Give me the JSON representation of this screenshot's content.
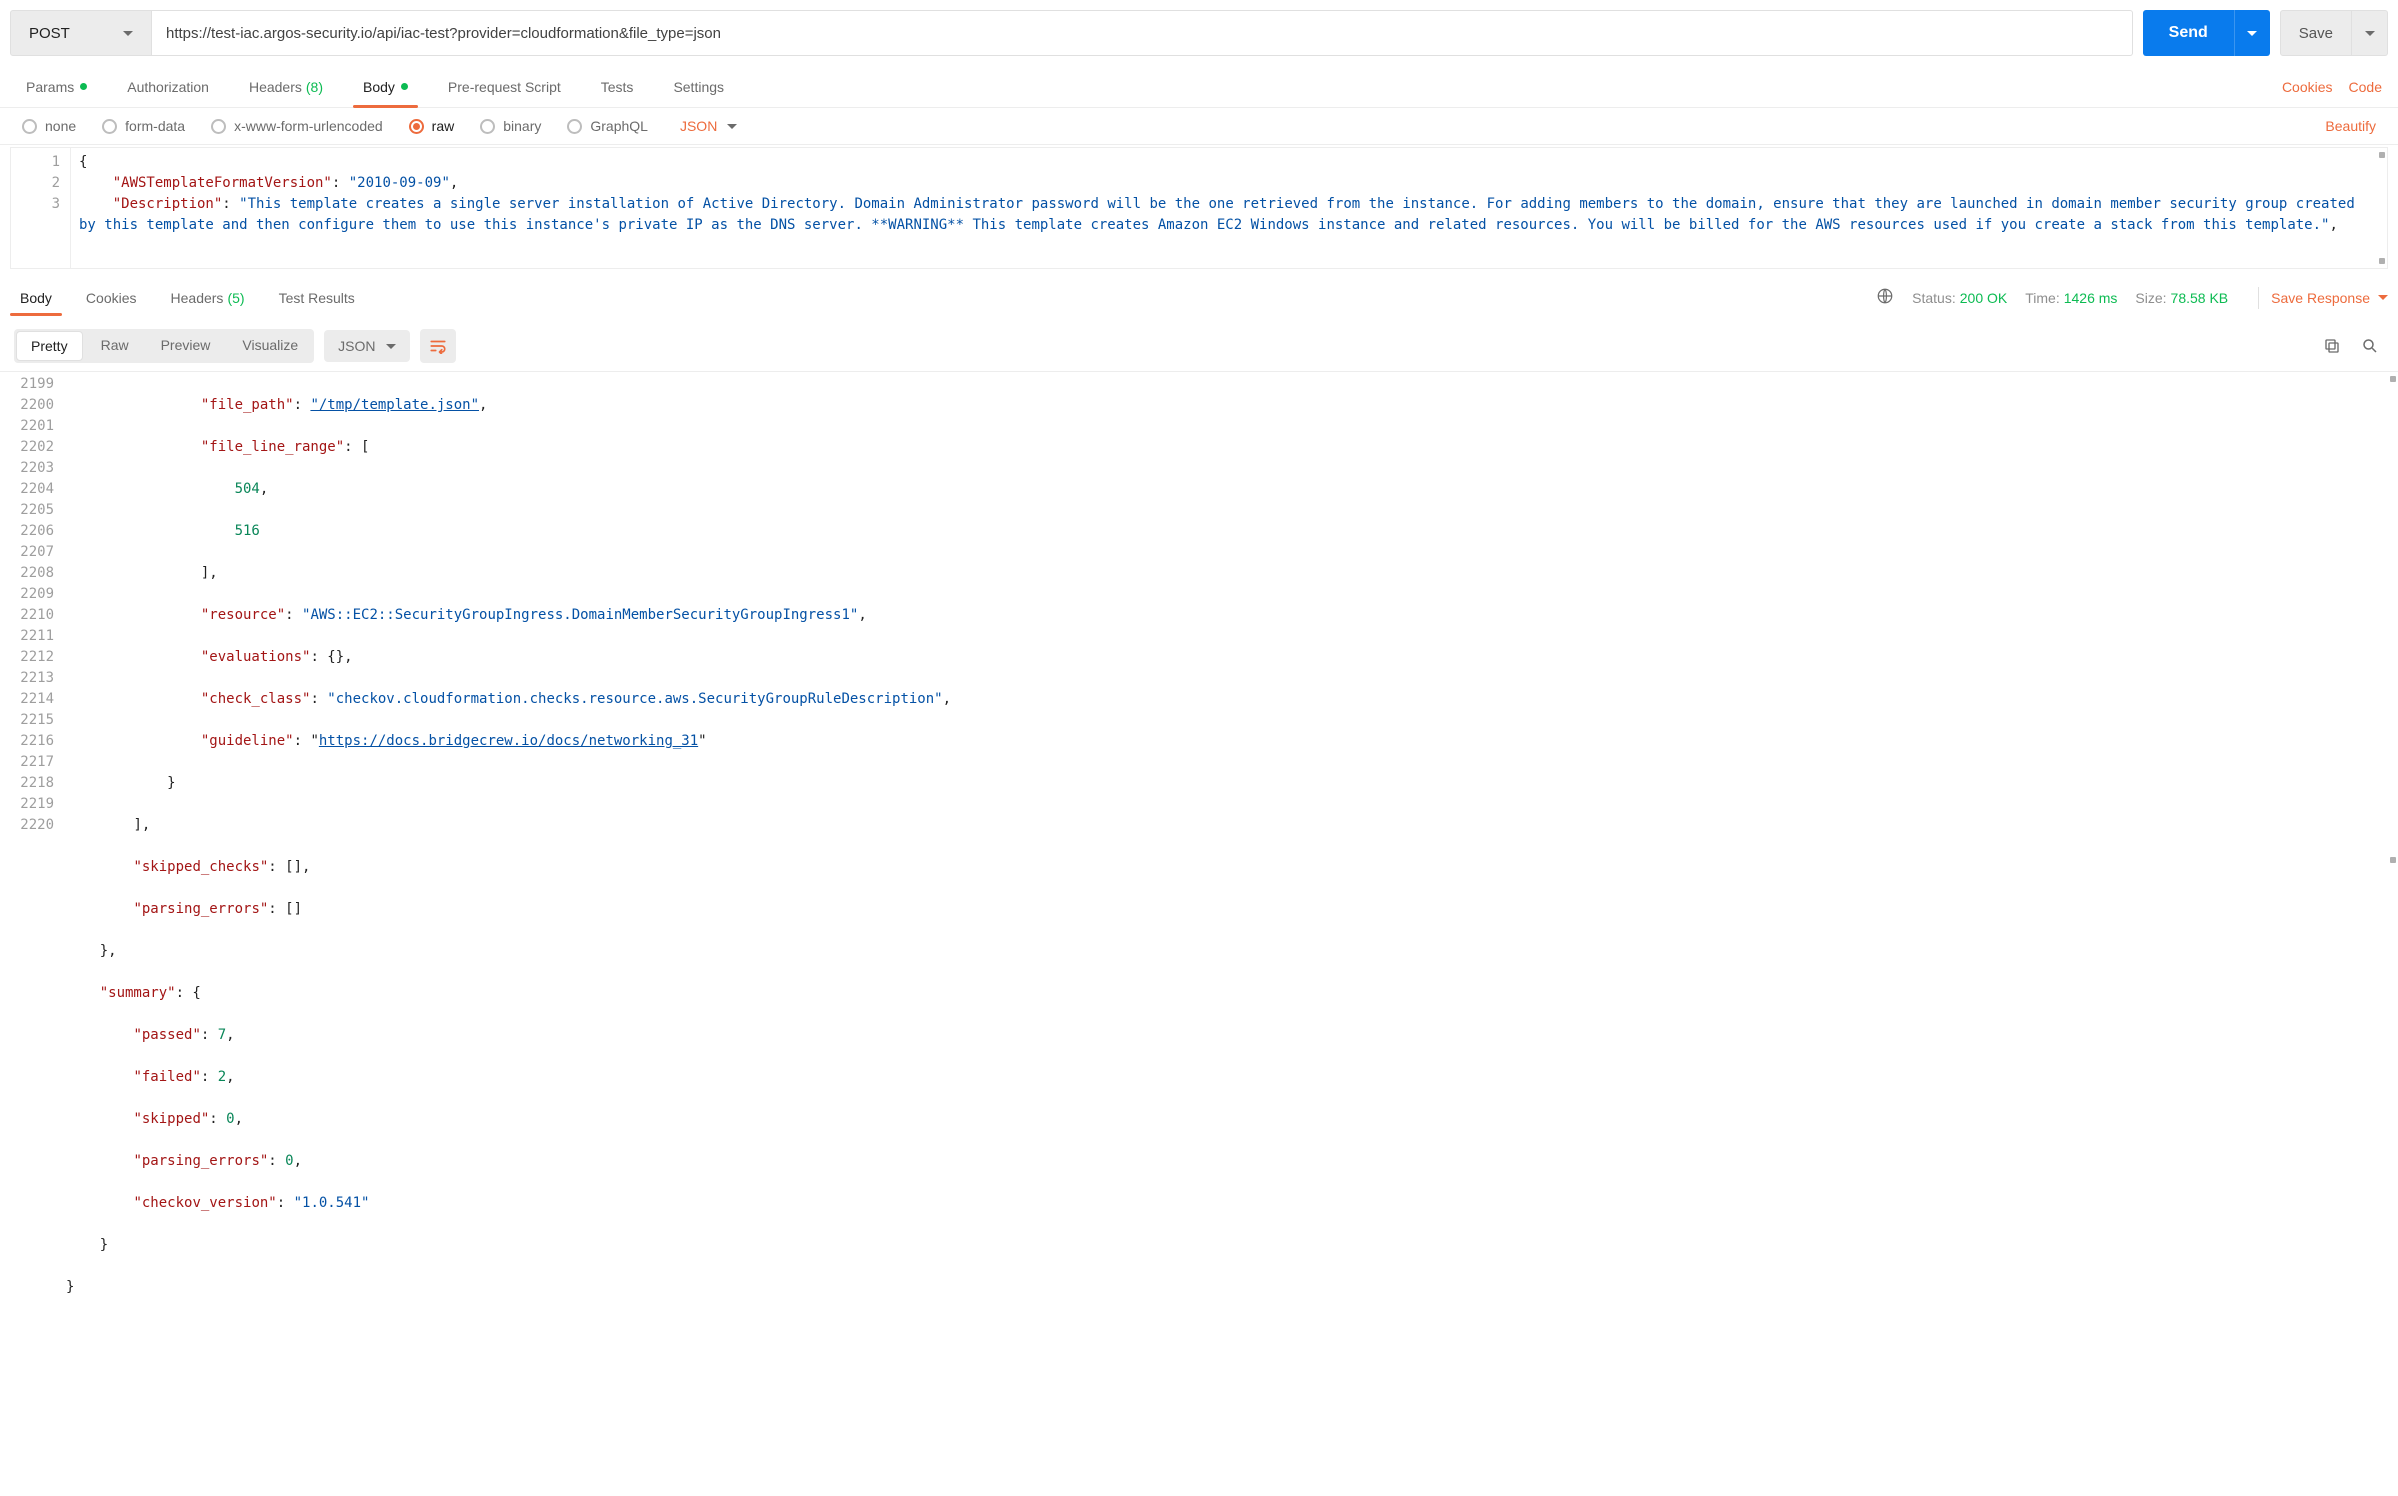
{
  "request": {
    "method": "POST",
    "url": "https://test-iac.argos-security.io/api/iac-test?provider=cloudformation&file_type=json",
    "send_label": "Send",
    "save_label": "Save"
  },
  "req_tabs": {
    "params": "Params",
    "authorization": "Authorization",
    "headers": "Headers",
    "headers_count": "(8)",
    "body": "Body",
    "prerequest": "Pre-request Script",
    "tests": "Tests",
    "settings": "Settings",
    "cookies": "Cookies",
    "code": "Code"
  },
  "body_types": {
    "none": "none",
    "form_data": "form-data",
    "urlencoded": "x-www-form-urlencoded",
    "raw": "raw",
    "binary": "binary",
    "graphql": "GraphQL",
    "format": "JSON",
    "beautify": "Beautify"
  },
  "request_body": {
    "lines": [
      "1",
      "2",
      "3"
    ],
    "l1": "{",
    "l2_k": "\"AWSTemplateFormatVersion\"",
    "l2_v": "\"2010-09-09\"",
    "l3_k": "\"Description\"",
    "l3_v": "\"This template creates a single server installation of Active Directory. Domain Administrator password will be the one retrieved from the instance. For adding members to the domain, ensure that they are launched in domain member security group created by this template and then configure them to use this instance's private IP as the DNS server. **WARNING** This template creates Amazon EC2 Windows instance and related resources. You will be billed for the AWS resources used if you create a stack from this template.\""
  },
  "resp_tabs": {
    "body": "Body",
    "cookies": "Cookies",
    "headers": "Headers",
    "headers_count": "(5)",
    "test_results": "Test Results"
  },
  "resp_meta": {
    "status_lbl": "Status:",
    "status_val": "200 OK",
    "time_lbl": "Time:",
    "time_val": "1426 ms",
    "size_lbl": "Size:",
    "size_val": "78.58 KB",
    "save_response": "Save Response"
  },
  "resp_view": {
    "pretty": "Pretty",
    "raw": "Raw",
    "preview": "Preview",
    "visualize": "Visualize",
    "format": "JSON"
  },
  "response_body": {
    "line_numbers": [
      "2199",
      "2200",
      "2201",
      "2202",
      "2203",
      "2204",
      "2205",
      "2206",
      "2207",
      "2208",
      "2209",
      "2210",
      "2211",
      "2212",
      "2213",
      "2214",
      "2215",
      "2216",
      "2217",
      "2218",
      "2219",
      "2220"
    ],
    "file_path_k": "\"file_path\"",
    "file_path_v": "\"/tmp/template.json\"",
    "file_line_range_k": "\"file_line_range\"",
    "flr_v1": "504",
    "flr_v2": "516",
    "resource_k": "\"resource\"",
    "resource_v": "\"AWS::EC2::SecurityGroupIngress.DomainMemberSecurityGroupIngress1\"",
    "evaluations_k": "\"evaluations\"",
    "check_class_k": "\"check_class\"",
    "check_class_v": "\"checkov.cloudformation.checks.resource.aws.SecurityGroupRuleDescription\"",
    "guideline_k": "\"guideline\"",
    "guideline_v": "https://docs.bridgecrew.io/docs/networking_31",
    "skipped_checks_k": "\"skipped_checks\"",
    "parsing_errors_k": "\"parsing_errors\"",
    "summary_k": "\"summary\"",
    "passed_k": "\"passed\"",
    "passed_v": "7",
    "failed_k": "\"failed\"",
    "failed_v": "2",
    "skipped_k": "\"skipped\"",
    "skipped_v": "0",
    "pe_k": "\"parsing_errors\"",
    "pe_v": "0",
    "checkov_k": "\"checkov_version\"",
    "checkov_v": "\"1.0.541\""
  }
}
